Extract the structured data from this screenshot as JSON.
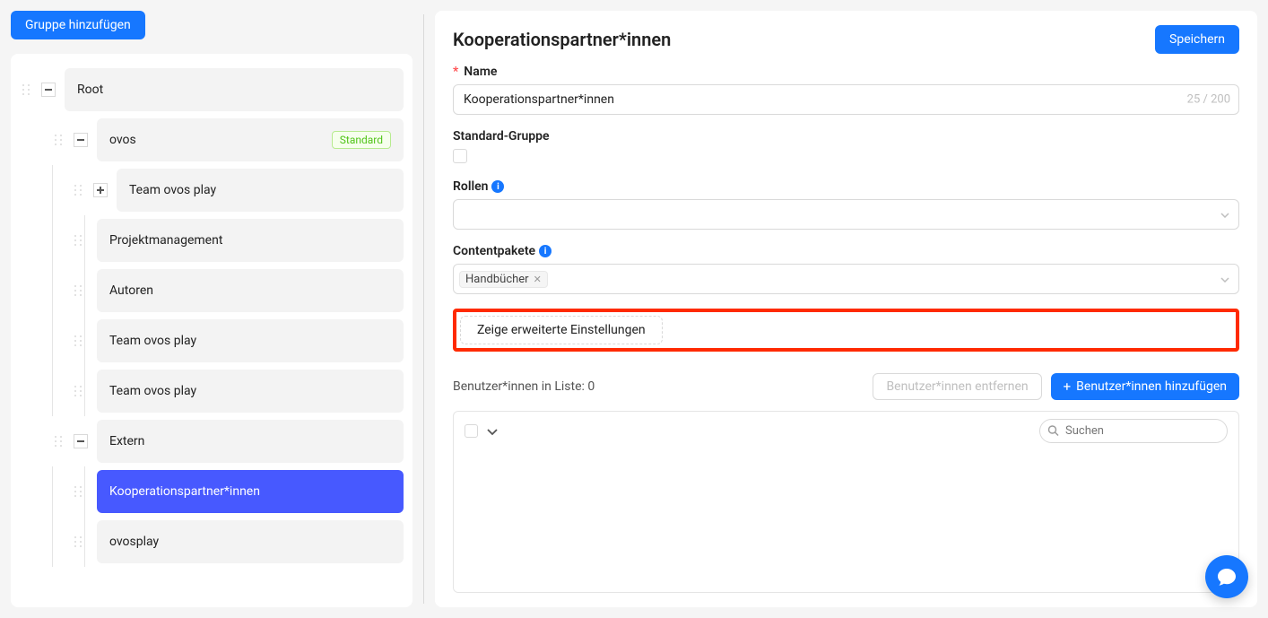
{
  "sidebar": {
    "add_group_label": "Gruppe hinzufügen",
    "tree": {
      "root_label": "Root",
      "ovos_label": "ovos",
      "ovos_badge": "Standard",
      "team_ovos_play_1": "Team ovos play",
      "projektmanagement": "Projektmanagement",
      "autoren": "Autoren",
      "team_ovos_play_2": "Team ovos play",
      "team_ovos_play_3": "Team ovos play",
      "extern_label": "Extern",
      "kooperationspartner": "Kooperationspartner*innen",
      "ovosplay": "ovosplay"
    }
  },
  "detail": {
    "title": "Kooperationspartner*innen",
    "save_label": "Speichern",
    "name_label": "Name",
    "name_value": "Kooperationspartner*innen",
    "name_count": "25 / 200",
    "standard_gruppe_label": "Standard-Gruppe",
    "rollen_label": "Rollen",
    "contentpakete_label": "Contentpakete",
    "contentpakete_tags": [
      "Handbücher"
    ],
    "advanced_label": "Zeige erweiterte Einstellungen",
    "users_in_list": "Benutzer*innen in Liste: 0",
    "users_remove": "Benutzer*innen entfernen",
    "users_add": "Benutzer*innen hinzufügen",
    "search_placeholder": "Suchen"
  }
}
